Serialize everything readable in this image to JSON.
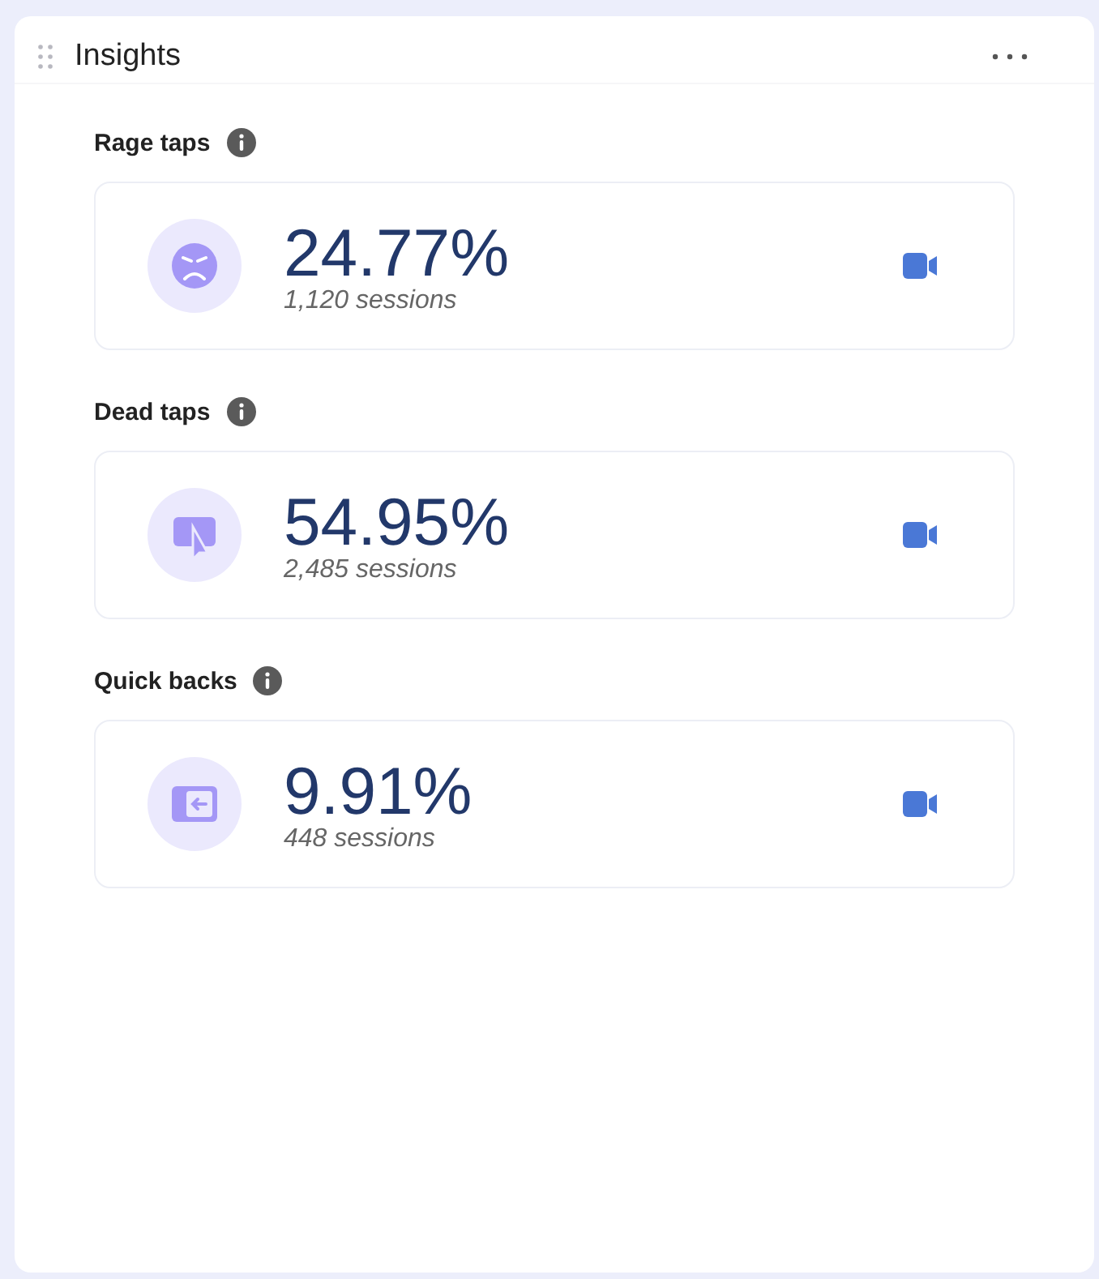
{
  "panel": {
    "title": "Insights"
  },
  "metrics": [
    {
      "kind": "rage",
      "label": "Rage taps",
      "value": "24.77%",
      "sessions": "1,120 sessions"
    },
    {
      "kind": "dead",
      "label": "Dead taps",
      "value": "54.95%",
      "sessions": "2,485 sessions"
    },
    {
      "kind": "quick",
      "label": "Quick backs",
      "value": "9.91%",
      "sessions": "448 sessions"
    }
  ]
}
